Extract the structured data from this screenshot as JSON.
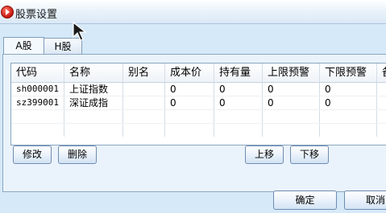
{
  "window": {
    "title": "股票设置"
  },
  "tabs": [
    {
      "label": "A股",
      "active": true
    },
    {
      "label": "H股",
      "active": false
    }
  ],
  "table": {
    "columns": [
      "代码",
      "名称",
      "别名",
      "成本价",
      "持有量",
      "上限预警",
      "下限预警",
      "备注"
    ],
    "rows": [
      {
        "code": "sh000001",
        "name": "上证指数",
        "alias": "",
        "cost": "0",
        "hold": "0",
        "upper": "0",
        "lower": "0",
        "note": ""
      },
      {
        "code": "sz399001",
        "name": "深证成指",
        "alias": "",
        "cost": "0",
        "hold": "0",
        "upper": "0",
        "lower": "0",
        "note": ""
      }
    ]
  },
  "buttons": {
    "edit": "修改",
    "delete": "删除",
    "move_up": "上移",
    "move_down": "下移",
    "ok": "确定",
    "cancel": "取消"
  }
}
